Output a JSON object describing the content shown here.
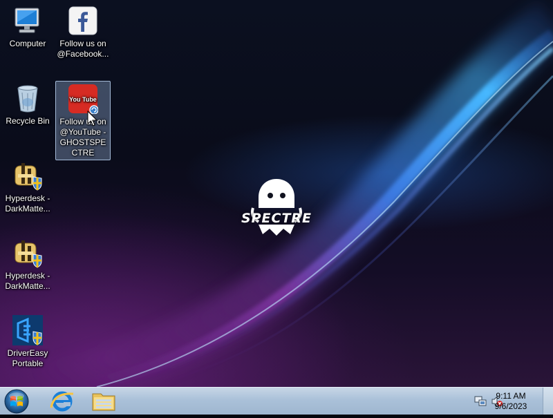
{
  "desktop_icons": [
    {
      "label": "Computer",
      "icon": "computer-icon"
    },
    {
      "label": "Follow us on @Facebook...",
      "icon": "facebook-icon"
    },
    {
      "label": "Recycle Bin",
      "icon": "recycle-bin-icon"
    },
    {
      "label": "Follow us on @YouTube - GHOSTSPECTRE",
      "icon": "youtube-icon",
      "selected": true
    },
    {
      "label": "Hyperdesk - DarkMatte...",
      "icon": "hyperdesk-icon"
    },
    {
      "label": "Hyperdesk - DarkMatte...",
      "icon": "hyperdesk-icon"
    },
    {
      "label": "DriverEasy Portable",
      "icon": "drivereasy-icon"
    }
  ],
  "youtube_badge": "You Tube",
  "wallpaper": {
    "logo_text": "SPECTRE",
    "logo_icon": "ghost-logo-icon"
  },
  "taskbar": {
    "start_icon": "windows-start-icon",
    "pinned": [
      {
        "icon": "internet-explorer-icon"
      },
      {
        "icon": "file-explorer-icon"
      }
    ],
    "tray_icons": [
      "network-icon",
      "volume-muted-icon"
    ],
    "time": "9:11 AM",
    "date": "9/6/2023"
  },
  "colors": {
    "taskbar": "#aac1d9",
    "selection": "#a0bee6",
    "youtube_red": "#d62b23",
    "facebook_blue": "#3b5998"
  }
}
